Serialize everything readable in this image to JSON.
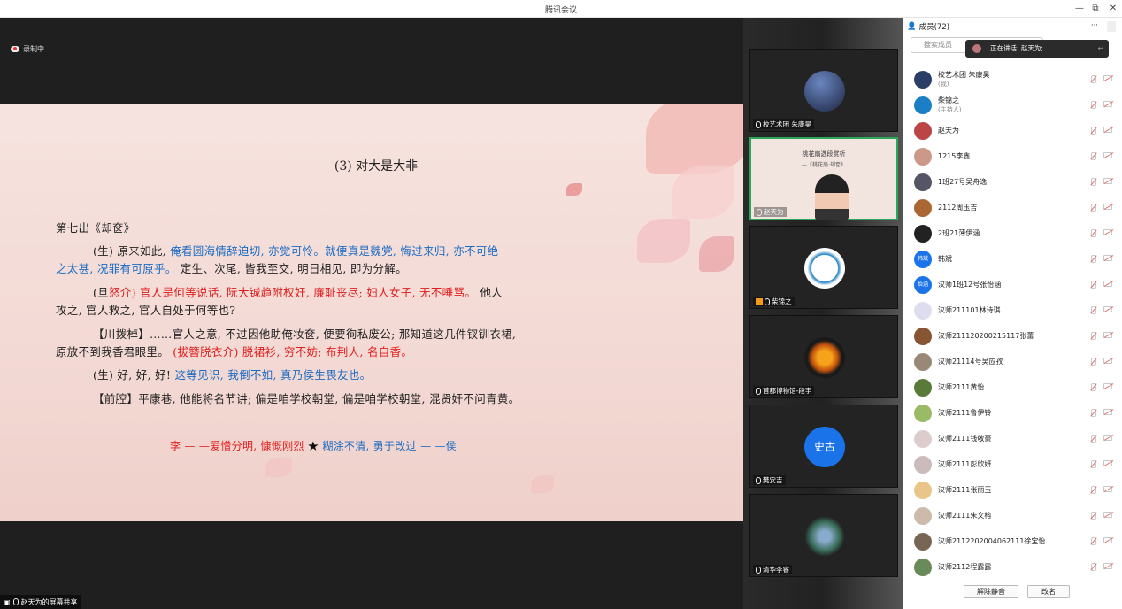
{
  "window": {
    "title": "腾讯会议",
    "min": "—",
    "max": "⧉",
    "close": "✕"
  },
  "recording": {
    "label": "录制中"
  },
  "slide": {
    "title": "(3) 对大是大非",
    "act": "第七出《却奁》",
    "l1_a": "(生) 原来如此,",
    "l1_b": "俺看圆海情辞迫切, 亦觉可怜。就便真是魏党, 悔过来归, 亦不可绝",
    "l2_a": "之太甚, 况罪有可原乎。",
    "l2_b": "定生、次尾, 皆我至交, 明日相见, 即为分解。",
    "l3_a": "(旦",
    "l3_b": "怒介) 官人是何等说话, 阮大铖趋附权奸, 廉耻丧尽; 妇人女子, 无不唾骂。",
    "l3_c": "他人",
    "l4": "攻之, 官人救之, 官人自处于何等也?",
    "l5": "【川拨棹】……官人之意, 不过因他助俺妆奁, 便要徇私废公; 那知道这几件钗钏衣裙,",
    "l6_a": "原放不到我香君眼里。",
    "l6_b": "(拔簪脱衣介) 脱裙衫, 穷不妨; 布荆人, 名自香。",
    "l7_a": "(生) 好, 好, 好!",
    "l7_b": "这等见识, 我倒不如, 真乃侯生畏友也。",
    "l8": "【前腔】平康巷, 他能将名节讲; 偏是咱学校朝堂, 偏是咱学校朝堂, 混贤奸不问青黄。",
    "summary_a": "李 — —爱憎分明, 慷慨刚烈",
    "summary_star": "★",
    "summary_b": "糊涂不清, 勇于改过 — —侯"
  },
  "presenter": {
    "label": "赵天为的屏幕共享"
  },
  "tiles": [
    {
      "name": "校艺术团 朱康昊",
      "color": "#2b3f66"
    },
    {
      "name": "赵天为",
      "color": "#f2e5e0",
      "slide_title": "桃花扇选段赏析",
      "slide_sub": "—《桃花扇·却奁》"
    },
    {
      "name": "柴锦之",
      "color": "#1a7fc4"
    },
    {
      "name": "首都博物馆-段宇",
      "color": "#e07a10"
    },
    {
      "name": "樊安吉",
      "avatar_text": "史古",
      "color": "#1a73e8"
    },
    {
      "name": "清华李睿",
      "color": "#3a6e5a"
    }
  ],
  "panel": {
    "title": "成员(72)",
    "more": "···",
    "search_placeholder": "搜索成员",
    "speaking": "正在讲话: 赵天为;",
    "members": [
      {
        "name": "校艺术团 朱康昊",
        "sub": "(我)",
        "color": "#2b3f66"
      },
      {
        "name": "柴锦之",
        "sub": "(主持人)",
        "color": "#1a7fc4"
      },
      {
        "name": "赵天为",
        "sub": "",
        "color": "#b44"
      },
      {
        "name": "1215李鑫",
        "sub": "",
        "color": "#c98"
      },
      {
        "name": "1班27号吴舟逸",
        "sub": "",
        "color": "#556"
      },
      {
        "name": "2112周玉吉",
        "sub": "",
        "color": "#a63"
      },
      {
        "name": "2班21薄伊涵",
        "sub": "",
        "color": "#222"
      },
      {
        "name": "韩斌",
        "sub": "",
        "color": "#1a73e8",
        "avatar_text": "韩斌"
      },
      {
        "name": "汉师1班12号张怡涵",
        "sub": "",
        "color": "#1a73e8",
        "avatar_text": "怡涵"
      },
      {
        "name": "汉师211101林诗琪",
        "sub": "",
        "color": "#dde"
      },
      {
        "name": "汉师211120200215117张蕾",
        "sub": "",
        "color": "#853"
      },
      {
        "name": "汉师21114号吴应孜",
        "sub": "",
        "color": "#987"
      },
      {
        "name": "汉师2111黄怡",
        "sub": "",
        "color": "#5a7a3a"
      },
      {
        "name": "汉师2111鲁伊铃",
        "sub": "",
        "color": "#9b6"
      },
      {
        "name": "汉师2111钱敬豪",
        "sub": "",
        "color": "#dcc"
      },
      {
        "name": "汉师2111彭欣妍",
        "sub": "",
        "color": "#cbb"
      },
      {
        "name": "汉师2111张丽玉",
        "sub": "",
        "color": "#e9c58a"
      },
      {
        "name": "汉师2111朱文榕",
        "sub": "",
        "color": "#cba"
      },
      {
        "name": "汉师2112202004062111徐宝怡",
        "sub": "",
        "color": "#765"
      },
      {
        "name": "汉师2112程露露",
        "sub": "",
        "color": "#6a8a5a"
      }
    ],
    "unmute_all": "解除静音",
    "rename": "改名"
  }
}
